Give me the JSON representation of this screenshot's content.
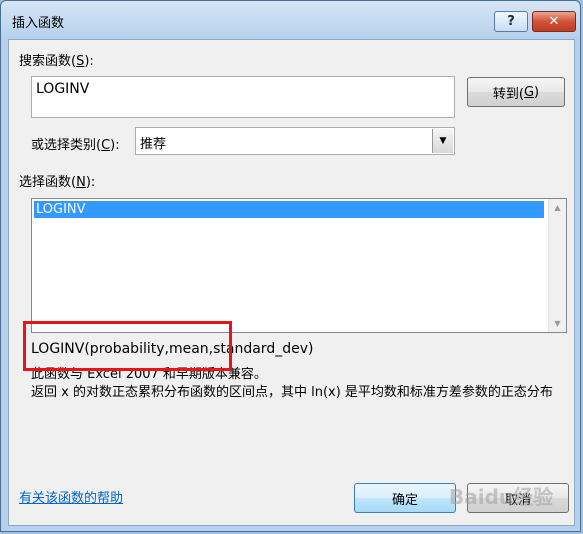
{
  "window": {
    "title": "插入函数",
    "help_button": "?",
    "close_button": "✕"
  },
  "search": {
    "label_prefix": "搜索函数(",
    "label_key": "S",
    "label_suffix": "):",
    "value": "LOGINV",
    "goto_prefix": "转到(",
    "goto_key": "G",
    "goto_suffix": ")"
  },
  "category": {
    "label_prefix": "或选择类别(",
    "label_key": "C",
    "label_suffix": "):",
    "selected": "推荐"
  },
  "functions": {
    "label_prefix": "选择函数(",
    "label_key": "N",
    "label_suffix": "):",
    "items": [
      "LOGINV"
    ]
  },
  "details": {
    "syntax": "LOGINV(probability,mean,standard_dev)",
    "compat": "此函数与 Excel 2007 和早期版本兼容。",
    "description": "返回 x 的对数正态累积分布函数的区间点，其中 ln(x) 是平均数和标准方差参数的正态分布"
  },
  "footer": {
    "help_link": "有关该函数的帮助",
    "ok": "确定",
    "cancel": "取消"
  },
  "watermark": "Baidu经验",
  "colors": {
    "selection": "#3399ff",
    "annotation_box": "#e8141b",
    "link": "#0066cc"
  }
}
